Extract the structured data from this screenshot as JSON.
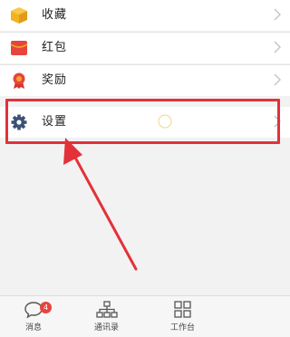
{
  "menu": {
    "items": [
      {
        "label": "收藏",
        "icon": "box-icon"
      },
      {
        "label": "红包",
        "icon": "red-envelope-icon"
      },
      {
        "label": "奖励",
        "icon": "award-ribbon-icon"
      },
      {
        "label": "设置",
        "icon": "gear-icon"
      }
    ]
  },
  "tabbar": {
    "tabs": [
      {
        "label": "消息",
        "icon": "chat-bubble-icon",
        "badge": "4"
      },
      {
        "label": "通讯录",
        "icon": "org-chart-icon"
      },
      {
        "label": "工作台",
        "icon": "grid-apps-icon"
      }
    ]
  },
  "colors": {
    "highlight": "#e3313a",
    "badge": "#e8443f",
    "box_icon": "#f2b323",
    "envelope_icon": "#e8443f",
    "award_icon": "#e8443f",
    "gear_icon": "#3a5276"
  }
}
